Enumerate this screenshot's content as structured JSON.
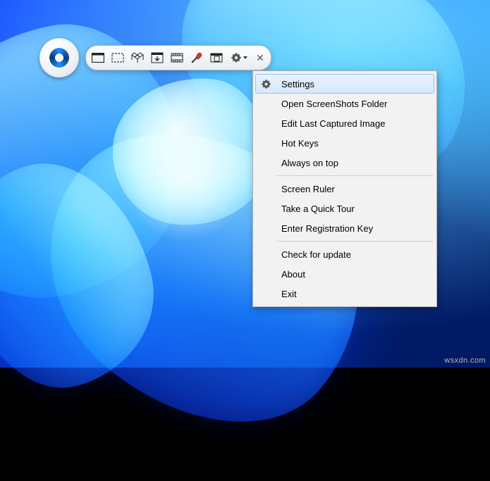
{
  "toolbar": {
    "buttons": [
      {
        "name": "capture-fullscreen-button",
        "icon": "fullscreen-icon"
      },
      {
        "name": "capture-region-button",
        "icon": "region-icon"
      },
      {
        "name": "capture-window-button",
        "icon": "window-icon"
      },
      {
        "name": "capture-scroll-button",
        "icon": "scroll-icon"
      },
      {
        "name": "record-video-button",
        "icon": "video-icon"
      },
      {
        "name": "color-picker-button",
        "icon": "eyedropper-icon"
      },
      {
        "name": "open-folder-button",
        "icon": "folder-icon"
      }
    ],
    "settings_button": {
      "name": "settings-dropdown-button",
      "icon": "gear-icon"
    },
    "close_button": {
      "name": "close-button",
      "icon": "close-icon"
    }
  },
  "menu": {
    "groups": [
      [
        {
          "key": "settings",
          "label": "Settings",
          "highlighted": true,
          "icon": "gear-icon"
        },
        {
          "key": "open_folder",
          "label": "Open ScreenShots Folder"
        },
        {
          "key": "edit_last",
          "label": "Edit Last Captured Image"
        },
        {
          "key": "hot_keys",
          "label": "Hot Keys"
        },
        {
          "key": "always_top",
          "label": "Always on top"
        }
      ],
      [
        {
          "key": "screen_ruler",
          "label": "Screen Ruler"
        },
        {
          "key": "quick_tour",
          "label": "Take a Quick Tour"
        },
        {
          "key": "enter_key",
          "label": "Enter Registration Key"
        }
      ],
      [
        {
          "key": "check_update",
          "label": "Check for update"
        },
        {
          "key": "about",
          "label": "About"
        },
        {
          "key": "exit",
          "label": "Exit"
        }
      ]
    ]
  },
  "watermark": "wsxdn.com"
}
